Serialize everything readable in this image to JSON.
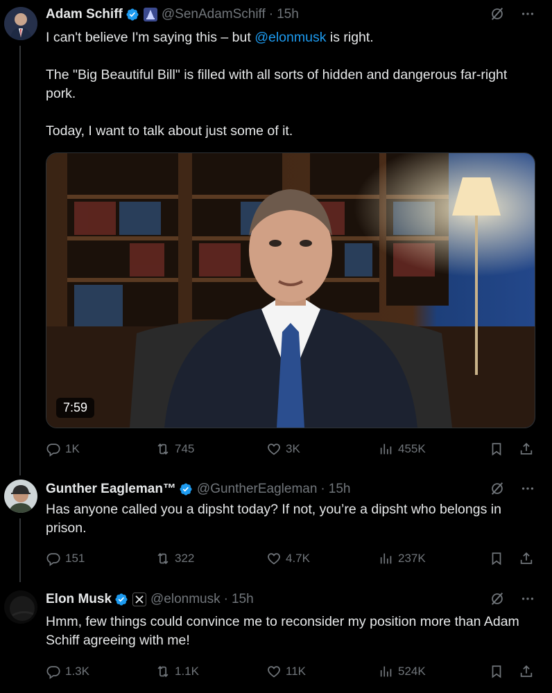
{
  "tweets": [
    {
      "name": "Adam Schiff",
      "handle": "@SenAdamSchiff",
      "time": "15h",
      "text_before_mention": "I can't believe I'm saying this – but ",
      "mention": "@elonmusk",
      "text_after_mention": " is right.",
      "para2": "The \"Big Beautiful Bill\" is filled with all sorts of hidden and dangerous far-right pork.",
      "para3": "Today, I want to talk about just some of it.",
      "video_duration": "7:59",
      "replies": "1K",
      "reposts": "745",
      "likes": "3K",
      "views": "455K"
    },
    {
      "name": "Gunther Eagleman™",
      "handle": "@GuntherEagleman",
      "time": "15h",
      "text": "Has anyone called you a dipsht today?  If not, you’re a dipsht who belongs in prison.",
      "replies": "151",
      "reposts": "322",
      "likes": "4.7K",
      "views": "237K"
    },
    {
      "name": "Elon Musk",
      "handle": "@elonmusk",
      "time": "15h",
      "text": "Hmm, few things could convince me to reconsider my position more than Adam Schiff agreeing with me!",
      "replies": "1.3K",
      "reposts": "1.1K",
      "likes": "11K",
      "views": "524K"
    }
  ],
  "colors": {
    "background": "#000000",
    "text": "#e7e9ea",
    "muted": "#71767b",
    "accent": "#1d9bf0",
    "divider": "#2f3336"
  },
  "icons": [
    "verified-badge-icon",
    "government-badge-icon",
    "x-logo-icon",
    "grok-icon",
    "more-icon",
    "reply-icon",
    "repost-icon",
    "like-icon",
    "views-icon",
    "bookmark-icon",
    "share-icon"
  ]
}
